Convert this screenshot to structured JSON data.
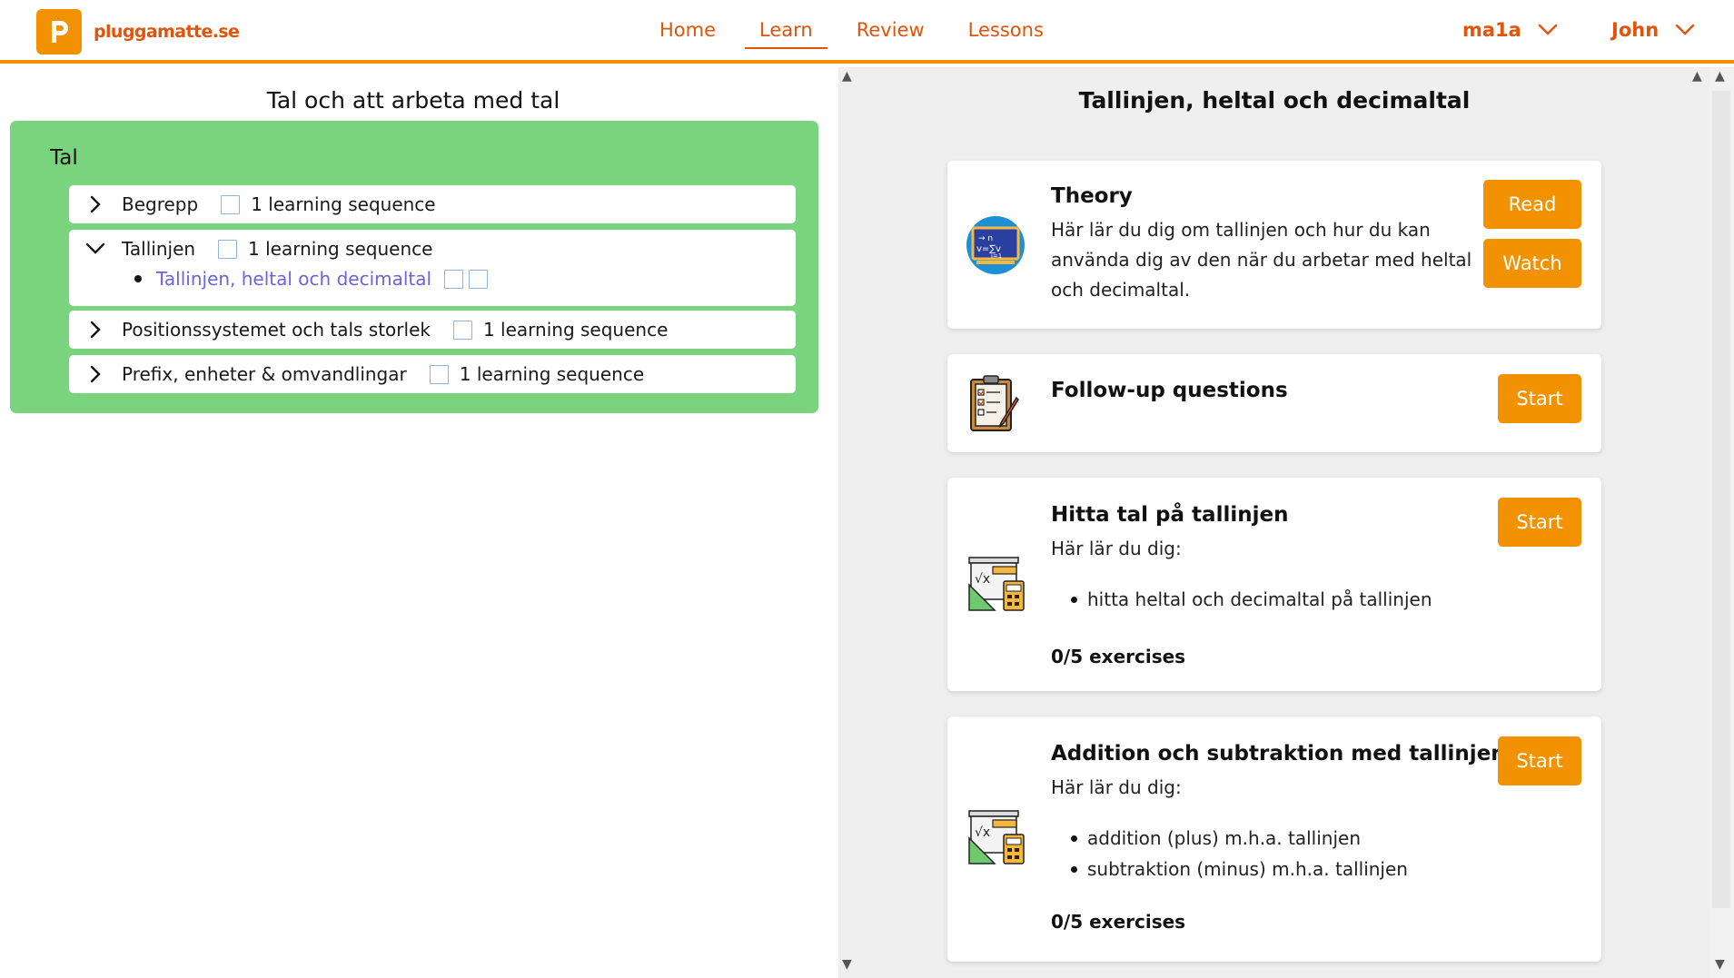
{
  "header": {
    "logo_text": "pluggamatte.se",
    "nav": [
      {
        "label": "Home"
      },
      {
        "label": "Learn"
      },
      {
        "label": "Review"
      },
      {
        "label": "Lessons"
      }
    ],
    "active_nav": "Learn",
    "course_selector": "ma1a",
    "user_menu": "John",
    "accent_color": "#f39200",
    "link_color": "#e2540a"
  },
  "left": {
    "title": "Tal och att arbeta med tal",
    "topic": "Tal",
    "card_color": "#7ad37d",
    "sections": [
      {
        "label": "Begrepp",
        "count": "1 learning sequence",
        "expanded": false
      },
      {
        "label": "Tallinjen",
        "count": "1 learning sequence",
        "expanded": true,
        "items": [
          {
            "label": "Tallinjen, heltal och decimaltal"
          }
        ]
      },
      {
        "label": "Positionssystemet och tals storlek",
        "count": "1 learning sequence",
        "expanded": false
      },
      {
        "label": "Prefix, enheter & omvandlingar",
        "count": "1 learning sequence",
        "expanded": false
      }
    ]
  },
  "right": {
    "title": "Tallinjen, heltal och decimaltal",
    "cards": [
      {
        "icon": "blackboard-formula-icon",
        "title": "Theory",
        "description": "Här lär du dig om tallinjen och hur du kan använda dig av den när du arbetar med heltal och decimaltal.",
        "buttons": [
          "Read",
          "Watch"
        ]
      },
      {
        "icon": "clipboard-checklist-icon",
        "title": "Follow-up questions",
        "buttons": [
          "Start"
        ]
      },
      {
        "icon": "math-tools-icon",
        "title": "Hitta tal på tallinjen",
        "intro": "Här lär du dig:",
        "bullets": [
          "hitta heltal och decimaltal på tallinjen"
        ],
        "progress": "0/5 exercises",
        "buttons": [
          "Start"
        ]
      },
      {
        "icon": "math-tools-icon",
        "title": "Addition och subtraktion med tallinjen",
        "intro": "Här lär du dig:",
        "bullets": [
          "addition (plus) m.h.a. tallinjen",
          "subtraktion (minus) m.h.a. tallinjen"
        ],
        "progress": "0/5 exercises",
        "buttons": [
          "Start"
        ]
      }
    ]
  }
}
